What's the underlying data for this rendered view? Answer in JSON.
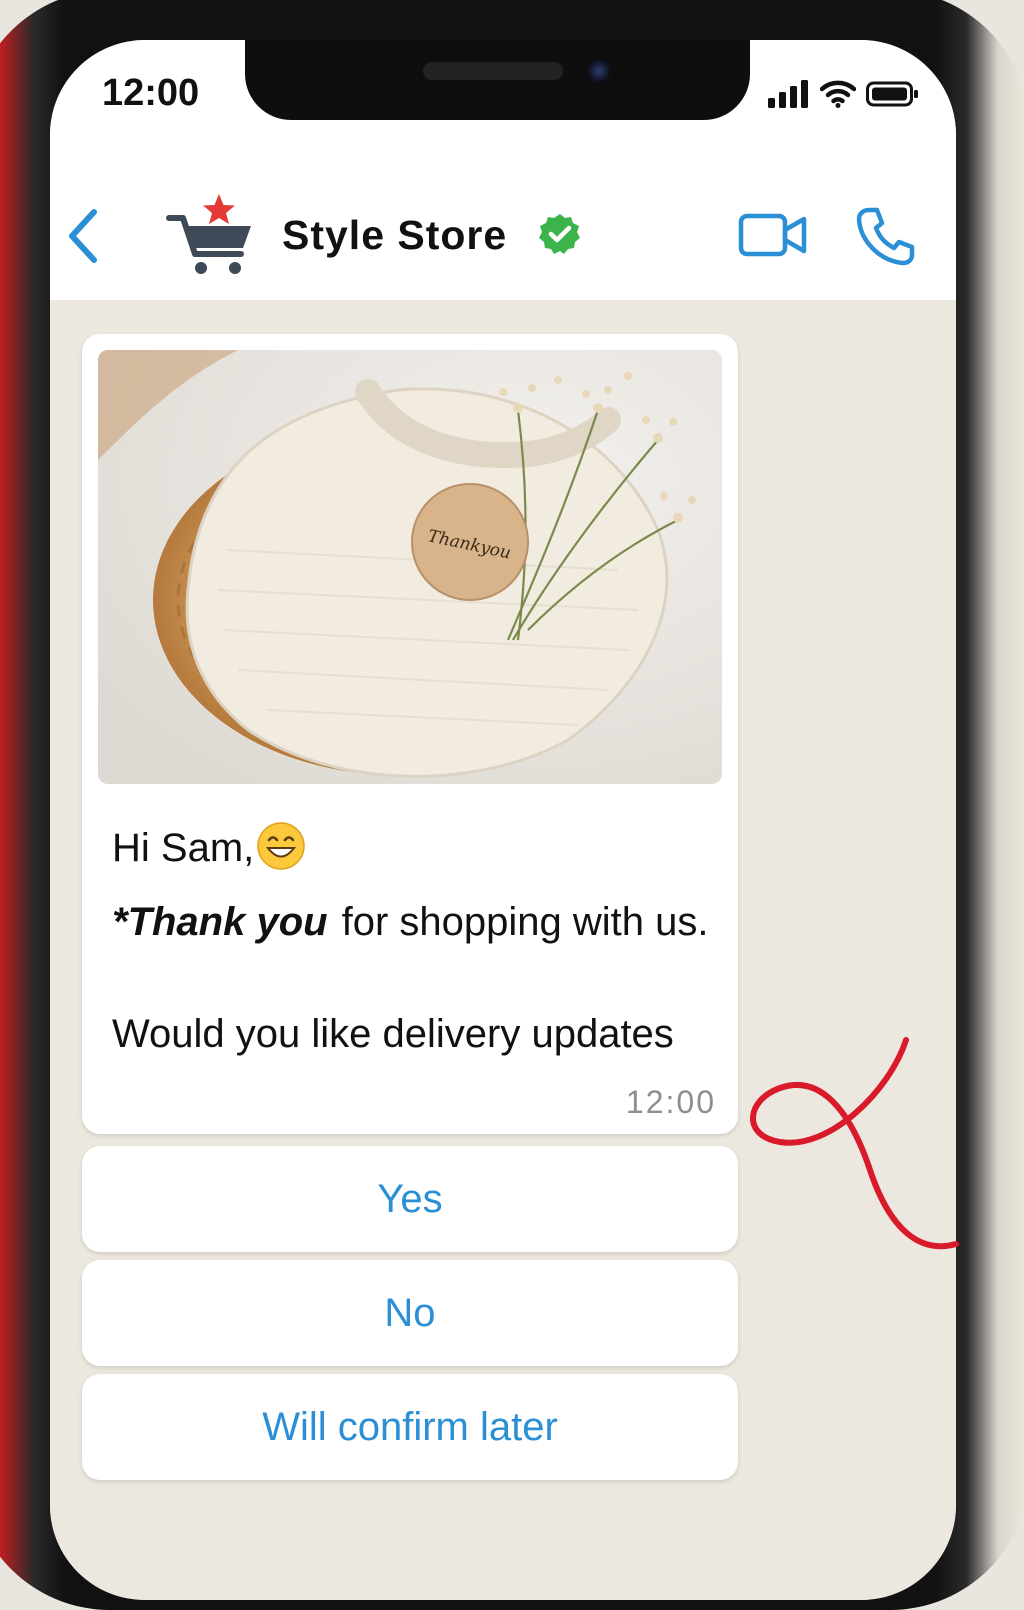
{
  "status_bar": {
    "time": "12:00"
  },
  "header": {
    "store_name": "Style Store",
    "icons": [
      "back-chevron-icon",
      "shopping-cart-star-icon",
      "verified-check-icon",
      "video-call-icon",
      "phone-call-icon"
    ]
  },
  "message": {
    "greeting": "Hi Sam,",
    "emoji": "grinning-face-emoji",
    "thanks_emphasis": "*Thank you",
    "thanks_rest": "for shopping with us.",
    "question": "Would you like delivery updates",
    "time": "12:00",
    "image_tag_text": "Thankyou"
  },
  "quick_replies": {
    "yes": "Yes",
    "no": "No",
    "later": "Will confirm later"
  },
  "colors": {
    "accent_blue": "#2b8fd6",
    "verified_green": "#3cb44b",
    "annotation_red": "#d81a2b",
    "chat_background": "#ece8e0"
  }
}
